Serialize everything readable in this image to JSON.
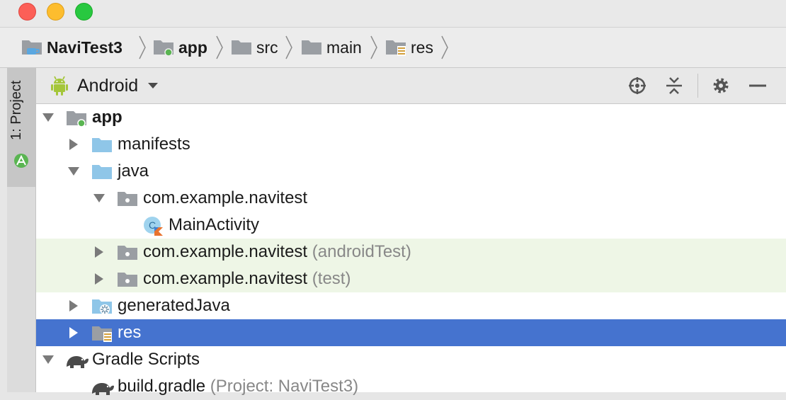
{
  "window": {
    "title_buttons": [
      "close",
      "minimize",
      "zoom"
    ]
  },
  "breadcrumb": [
    {
      "label": "NaviTest3",
      "icon": "project-folder-icon",
      "bold": true
    },
    {
      "label": "app",
      "icon": "module-folder-icon",
      "bold": true
    },
    {
      "label": "src",
      "icon": "folder-icon",
      "bold": false
    },
    {
      "label": "main",
      "icon": "folder-icon",
      "bold": false
    },
    {
      "label": "res",
      "icon": "resource-folder-icon",
      "bold": false
    }
  ],
  "sidebar": {
    "project_tab_label": "1: Project"
  },
  "toolbar": {
    "view_label": "Android",
    "icons": [
      "locate-icon",
      "collapse-all-icon",
      "gear-icon",
      "hide-icon"
    ]
  },
  "tree": [
    {
      "label": "app",
      "suffix": "",
      "bold": true,
      "arrow": "expanded",
      "level": 0,
      "icon": "module-folder-icon",
      "state": "normal"
    },
    {
      "label": "manifests",
      "suffix": "",
      "bold": false,
      "arrow": "collapsed",
      "level": 1,
      "icon": "folder-icon",
      "state": "normal"
    },
    {
      "label": "java",
      "suffix": "",
      "bold": false,
      "arrow": "expanded",
      "level": 1,
      "icon": "folder-icon",
      "state": "normal"
    },
    {
      "label": "com.example.navitest",
      "suffix": "",
      "bold": false,
      "arrow": "expanded",
      "level": 2,
      "icon": "package-icon",
      "state": "normal"
    },
    {
      "label": "MainActivity",
      "suffix": "",
      "bold": false,
      "arrow": "none",
      "level": 3,
      "icon": "kotlin-class-icon",
      "state": "normal"
    },
    {
      "label": "com.example.navitest",
      "suffix": "(androidTest)",
      "bold": false,
      "arrow": "collapsed",
      "level": 2,
      "icon": "package-icon",
      "state": "tinted"
    },
    {
      "label": "com.example.navitest",
      "suffix": "(test)",
      "bold": false,
      "arrow": "collapsed",
      "level": 2,
      "icon": "package-icon",
      "state": "tinted"
    },
    {
      "label": "generatedJava",
      "suffix": "",
      "bold": false,
      "arrow": "collapsed",
      "level": 1,
      "icon": "generated-folder-icon",
      "state": "normal"
    },
    {
      "label": "res",
      "suffix": "",
      "bold": false,
      "arrow": "collapsed",
      "level": 1,
      "icon": "resource-folder-icon",
      "state": "selected"
    },
    {
      "label": "Gradle Scripts",
      "suffix": "",
      "bold": false,
      "arrow": "expanded",
      "level": 0,
      "icon": "gradle-elephant-icon",
      "state": "normal"
    },
    {
      "label": "build.gradle",
      "suffix": "(Project: NaviTest3)",
      "bold": false,
      "arrow": "none",
      "level": 1,
      "icon": "gradle-elephant-icon",
      "state": "normal"
    }
  ],
  "colors": {
    "selection": "#4573cf",
    "test_tint": "#eef6e6",
    "folder_blue": "#8fc6e8",
    "folder_gray": "#9a9ea3",
    "android_green": "#a4c639",
    "module_dot": "#5ab552"
  }
}
